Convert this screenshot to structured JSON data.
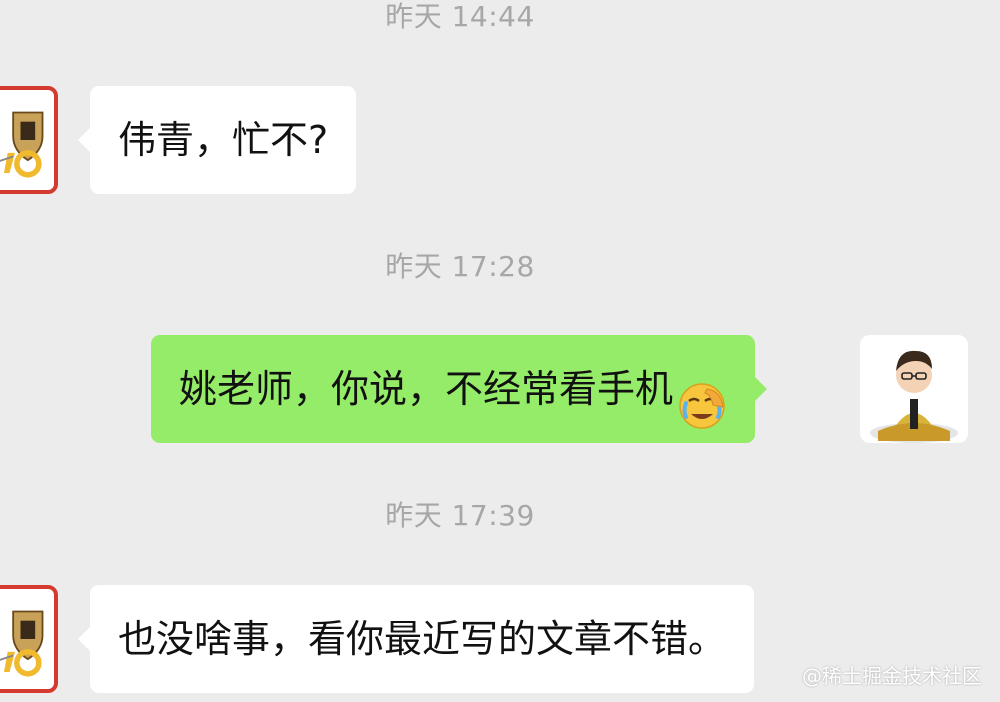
{
  "messages": [
    {
      "time": "昨天 14:44",
      "text": "伟青，忙不?"
    },
    {
      "time": "昨天 17:28",
      "text": "姚老师，你说，不经常看手机"
    },
    {
      "time": "昨天 17:39",
      "text": "也没啥事，看你最近写的文章不错。"
    }
  ],
  "icons": {
    "left_avatar": "porsche-70-avatar-icon",
    "right_avatar": "person-meditating-avatar-icon",
    "emoji": "face-palm-crying-emoji"
  },
  "colors": {
    "background": "#ececec",
    "incoming_bubble": "#ffffff",
    "outgoing_bubble": "#95ec69",
    "timestamp": "#a7a7a7"
  },
  "watermark": "@稀土掘金技术社区"
}
